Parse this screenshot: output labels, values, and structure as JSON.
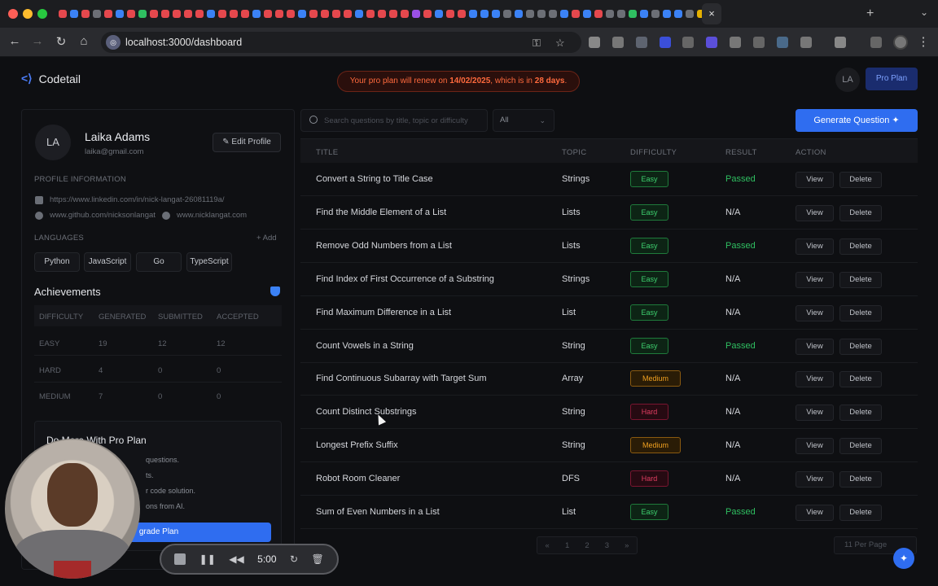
{
  "browser": {
    "url": "localhost:3000/dashboard",
    "tab_icon_colors": [
      "#e5484d",
      "#3b82f6",
      "#e5484d",
      "#6c6f76",
      "#e5484d",
      "#3b82f6",
      "#e5484d",
      "#2fbf61",
      "#e5484d",
      "#e5484d",
      "#e5484d",
      "#e5484d",
      "#e5484d",
      "#3b82f6",
      "#e5484d",
      "#e5484d",
      "#e5484d",
      "#3b82f6",
      "#e5484d",
      "#e5484d",
      "#e5484d",
      "#3b82f6",
      "#e5484d",
      "#e5484d",
      "#e5484d",
      "#e5484d",
      "#3b82f6",
      "#e5484d",
      "#e5484d",
      "#e5484d",
      "#e5484d",
      "#9a50e5",
      "#e5484d",
      "#3b82f6",
      "#e5484d",
      "#e5484d",
      "#3b82f6",
      "#3b82f6",
      "#3b82f6",
      "#6c6f76",
      "#3b82f6",
      "#6c6f76",
      "#6c6f76",
      "#6c6f76",
      "#3b82f6",
      "#e5484d",
      "#3b82f6",
      "#e5484d",
      "#6c6f76",
      "#6c6f76",
      "#2fbf61",
      "#3b82f6",
      "#6c6f76",
      "#3b82f6",
      "#3b82f6",
      "#6c6f76",
      "#e5b000",
      "#6c6f76"
    ],
    "icons": {
      "back": "←",
      "forward": "→",
      "reload": "↻",
      "home": "⌂",
      "star": "☆",
      "key": "⚿",
      "new_tab": "+",
      "close_tab": "×",
      "menu": "⋮",
      "tab_menu": "⌄"
    }
  },
  "header": {
    "app_name": "Codetail",
    "banner_prefix": "Your pro plan will renew on ",
    "banner_date": "14/02/2025",
    "banner_mid": ", which is in ",
    "banner_days": "28 days",
    "banner_suffix": ".",
    "avatar_initials": "LA",
    "pro_button": "Pro Plan"
  },
  "profile": {
    "initials": "LA",
    "name": "Laika Adams",
    "email": "laika@gmail.com",
    "edit_label": "Edit Profile",
    "section_label": "PROFILE INFORMATION",
    "linkedin": "https://www.linkedin.com/in/nick-langat-26081119a/",
    "github": "www.github.com/nicksonlangat",
    "website": "www.nicklangat.com",
    "languages_label": "LANGUAGES",
    "add_label": "Add",
    "languages": [
      "Python",
      "JavaScript",
      "Go",
      "TypeScript"
    ]
  },
  "achievements": {
    "title": "Achievements",
    "headers": [
      "DIFFICULTY",
      "GENERATED",
      "SUBMITTED",
      "ACCEPTED"
    ],
    "rows": [
      [
        "EASY",
        "19",
        "12",
        "12"
      ],
      [
        "HARD",
        "4",
        "0",
        "0"
      ],
      [
        "MEDIUM",
        "7",
        "0",
        "0"
      ]
    ]
  },
  "promo": {
    "title": "Do More With Pro Plan",
    "items": [
      "questions.",
      "ts.",
      "r code solution.",
      "ons from AI."
    ],
    "button": "grade Plan"
  },
  "recorder": {
    "time": "5:00",
    "icons": {
      "pause": "❚❚",
      "rewind": "◀◀",
      "restart": "↻",
      "trash": "🗑"
    }
  },
  "controls": {
    "search_placeholder": "Search questions by title, topic or difficulty",
    "filter_value": "All",
    "generate_label": "Generate Question"
  },
  "table": {
    "headers": {
      "title": "TITLE",
      "topic": "TOPIC",
      "difficulty": "DIFFICULTY",
      "result": "RESULT",
      "action": "ACTION"
    },
    "view_label": "View",
    "delete_label": "Delete",
    "rows": [
      {
        "title": "Convert a String to Title Case",
        "topic": "Strings",
        "difficulty": "Easy",
        "result": "Passed"
      },
      {
        "title": "Find the Middle Element of a List",
        "topic": "Lists",
        "difficulty": "Easy",
        "result": "N/A"
      },
      {
        "title": "Remove Odd Numbers from a List",
        "topic": "Lists",
        "difficulty": "Easy",
        "result": "Passed"
      },
      {
        "title": "Find Index of First Occurrence of a Substring",
        "topic": "Strings",
        "difficulty": "Easy",
        "result": "N/A"
      },
      {
        "title": "Find Maximum Difference in a List",
        "topic": "List",
        "difficulty": "Easy",
        "result": "N/A"
      },
      {
        "title": "Count Vowels in a String",
        "topic": "String",
        "difficulty": "Easy",
        "result": "Passed"
      },
      {
        "title": "Find Continuous Subarray with Target Sum",
        "topic": "Array",
        "difficulty": "Medium",
        "result": "N/A"
      },
      {
        "title": "Count Distinct Substrings",
        "topic": "String",
        "difficulty": "Hard",
        "result": "N/A"
      },
      {
        "title": "Longest Prefix Suffix",
        "topic": "String",
        "difficulty": "Medium",
        "result": "N/A"
      },
      {
        "title": "Robot Room Cleaner",
        "topic": "DFS",
        "difficulty": "Hard",
        "result": "N/A"
      },
      {
        "title": "Sum of Even Numbers in a List",
        "topic": "List",
        "difficulty": "Easy",
        "result": "Passed"
      }
    ]
  },
  "pagination": {
    "pages": [
      "1",
      "2",
      "3"
    ],
    "first_icon": "«",
    "last_icon": "»",
    "per_page": "11 Per Page"
  },
  "colors": {
    "accent": "#2f6df0",
    "easy": "#3ecf6e",
    "medium": "#f0a020",
    "hard": "#e23e62",
    "passed": "#2fbf61"
  }
}
